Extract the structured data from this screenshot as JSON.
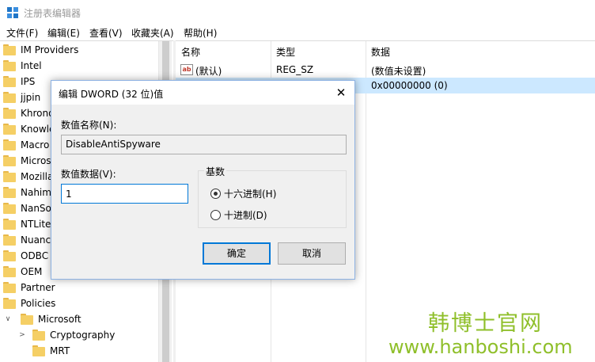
{
  "window": {
    "title": "注册表编辑器"
  },
  "menu": [
    {
      "label": "文件(F)"
    },
    {
      "label": "编辑(E)"
    },
    {
      "label": "查看(V)"
    },
    {
      "label": "收藏夹(A)"
    },
    {
      "label": "帮助(H)"
    }
  ],
  "tree": {
    "items": [
      {
        "label": "IM Providers"
      },
      {
        "label": "Intel"
      },
      {
        "label": "IPS"
      },
      {
        "label": "jjpin"
      },
      {
        "label": "Khrono"
      },
      {
        "label": "Knowle"
      },
      {
        "label": "Macro"
      },
      {
        "label": "Micros"
      },
      {
        "label": "Mozilla"
      },
      {
        "label": "Nahim"
      },
      {
        "label": "NanSo"
      },
      {
        "label": "NTLite"
      },
      {
        "label": "Nuance"
      },
      {
        "label": "ODBC"
      },
      {
        "label": "OEM"
      },
      {
        "label": "Partner"
      },
      {
        "label": "Policies"
      }
    ],
    "expanded": {
      "label": "Microsoft",
      "expander": "∨"
    },
    "children": [
      {
        "label": "Cryptography",
        "expander": ">"
      },
      {
        "label": "MRT",
        "expander": ""
      }
    ]
  },
  "list": {
    "headers": {
      "name": "名称",
      "type": "类型",
      "data": "数据"
    },
    "rows": [
      {
        "icon": "ab",
        "name": "(默认)",
        "type": "REG_SZ",
        "data": "(数值未设置)"
      },
      {
        "icon": "",
        "name": "",
        "type": "",
        "data": "0x00000000 (0)"
      }
    ]
  },
  "dialog": {
    "title": "编辑 DWORD (32 位)值",
    "close_glyph": "✕",
    "name_label": "数值名称(N):",
    "name_value": "DisableAntiSpyware",
    "data_label": "数值数据(V):",
    "data_value": "1",
    "base_label": "基数",
    "radio_hex": "十六进制(H)",
    "radio_dec": "十进制(D)",
    "ok": "确定",
    "cancel": "取消"
  },
  "watermark": {
    "name": "韩博士官网",
    "url": "www.hanboshi.com"
  },
  "colors": {
    "selection": "#cce8ff",
    "accent": "#0078d7",
    "folder": "#f5cf65",
    "watermark": "#8fbf2a"
  }
}
